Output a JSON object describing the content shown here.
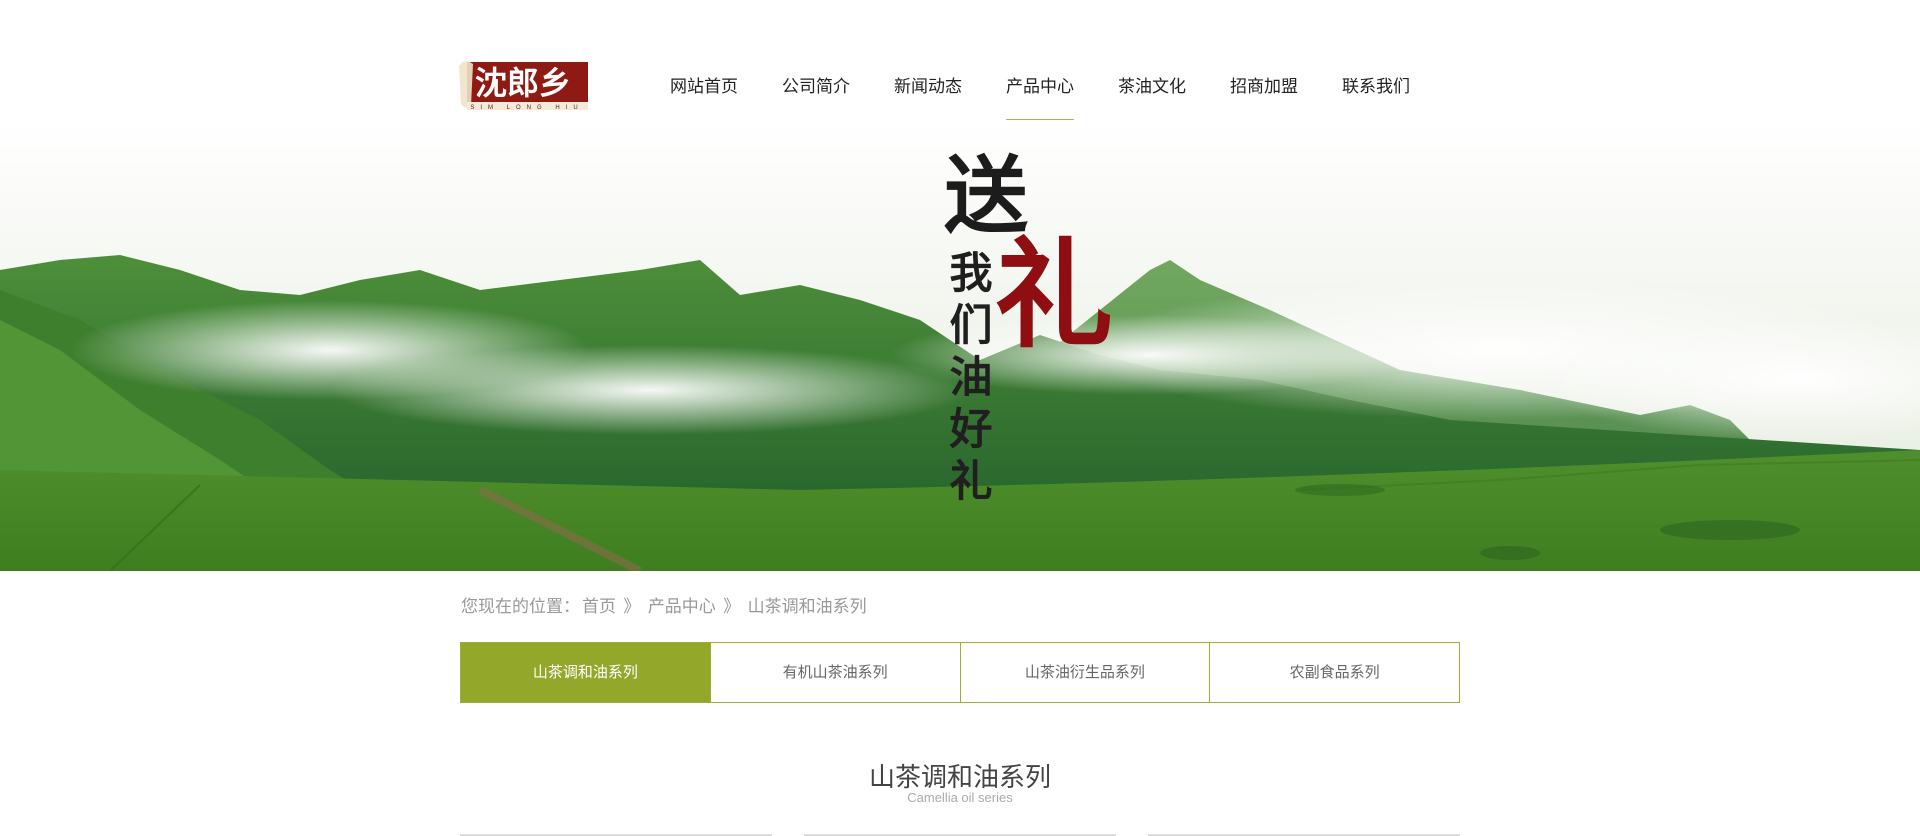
{
  "logo": {
    "main": "沈郎乡",
    "sub": "SIM LONG HIU"
  },
  "nav": [
    "网站首页",
    "公司简介",
    "新闻动态",
    "产品中心",
    "茶油文化",
    "招商加盟",
    "联系我们"
  ],
  "nav_active_index": 3,
  "banner": {
    "slogan_top": "送",
    "slogan_red": "礼",
    "slogan_vertical": [
      "我",
      "们",
      "油",
      "好",
      "礼"
    ]
  },
  "breadcrumb": {
    "prefix": "您现在的位置：",
    "items": [
      "首页",
      "》",
      "产品中心",
      "》",
      "山茶调和油系列"
    ]
  },
  "tabs": [
    "山茶调和油系列",
    "有机山茶油系列",
    "山茶油衍生品系列",
    "农副食品系列"
  ],
  "tabs_active_index": 0,
  "section": {
    "title": "山茶调和油系列",
    "subtitle": "Camellia oil series"
  },
  "colors": {
    "accent": "#93a72a",
    "brand_red": "#8f0e12",
    "tab_border": "#9ab035"
  }
}
